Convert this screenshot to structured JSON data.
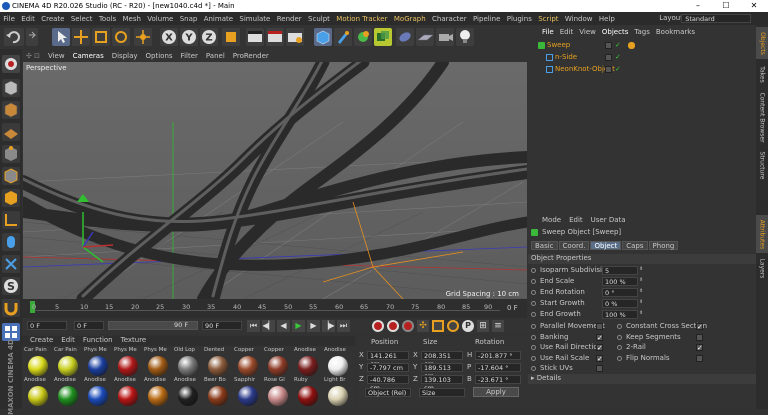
{
  "window": {
    "title": "CINEMA 4D R20.026 Studio (RC - R20) - [new1040.c4d *] - Main",
    "min": "–",
    "max": "☐",
    "close": "✕"
  },
  "menu": [
    "File",
    "Edit",
    "Create",
    "Select",
    "Tools",
    "Mesh",
    "Volume",
    "Snap",
    "Animate",
    "Simulate",
    "Render",
    "Sculpt",
    "Motion Tracker",
    "MoGraph",
    "Character",
    "Pipeline",
    "Plugins",
    "Script",
    "Window",
    "Help"
  ],
  "layout": {
    "label": "Layout:",
    "value": "Standard"
  },
  "axes": [
    "X",
    "Y",
    "Z"
  ],
  "view_menu": [
    "View",
    "Cameras",
    "Display",
    "Options",
    "Filter",
    "Panel",
    "ProRender"
  ],
  "viewport": {
    "label": "Perspective",
    "grid_spacing": "Grid Spacing : 10 cm"
  },
  "timeline": {
    "ticks": [
      "0",
      "5",
      "10",
      "15",
      "20",
      "25",
      "30",
      "35",
      "40",
      "45",
      "50",
      "55",
      "60",
      "65",
      "70",
      "75",
      "80",
      "85",
      "90"
    ],
    "end_label": "0 F"
  },
  "transport": {
    "start": "0 F",
    "current": "0 F",
    "end_a": "90 F",
    "end_b": "90 F"
  },
  "materials_menu": [
    "Create",
    "Edit",
    "Function",
    "Texture"
  ],
  "materials_row1": [
    {
      "name": "Car Pain",
      "color": "#d8d81a"
    },
    {
      "name": "Car Pain",
      "color": "#c8d020"
    },
    {
      "name": "Phys Me",
      "color": "#1a3e9e"
    },
    {
      "name": "Phys Me",
      "color": "#b01818"
    },
    {
      "name": "Phys Me",
      "color": "#a05a14"
    },
    {
      "name": "Old Lop",
      "color": "#7a7a7a"
    },
    {
      "name": "Dented",
      "color": "#8a5a3a"
    },
    {
      "name": "Copper",
      "color": "#9a4a2a"
    },
    {
      "name": "Copper",
      "color": "#8e3c28"
    },
    {
      "name": "Anodise",
      "color": "#7a1e1e"
    },
    {
      "name": "Anodise",
      "color": "#eeeeee"
    }
  ],
  "materials_row2": [
    {
      "name": "Anodise",
      "color": "#c8c818"
    },
    {
      "name": "Anodise",
      "color": "#1e8e1e"
    },
    {
      "name": "Anodise",
      "color": "#1a4ab8"
    },
    {
      "name": "Anodise",
      "color": "#b81414"
    },
    {
      "name": "Anodise",
      "color": "#b86a14"
    },
    {
      "name": "Anodise",
      "color": "#202020"
    },
    {
      "name": "Beer Bo",
      "color": "#8a3a1a"
    },
    {
      "name": "Sapphir",
      "color": "#2a3a8a"
    },
    {
      "name": "Rose Gl",
      "color": "#c88a8a"
    },
    {
      "name": "Ruby",
      "color": "#8e1010"
    },
    {
      "name": "Light Br",
      "color": "#d8d0b0"
    }
  ],
  "coords": {
    "headers": [
      "Position",
      "Size",
      "Rotation"
    ],
    "rows": [
      {
        "axis": "X",
        "pos": "141.261 cm",
        "sa": "X",
        "size": "208.351 cm",
        "ra": "H",
        "rot": "-201.877 °"
      },
      {
        "axis": "Y",
        "pos": "-7.797 cm",
        "sa": "Y",
        "size": "189.513 cm",
        "ra": "P",
        "rot": "-17.604 °"
      },
      {
        "axis": "Z",
        "pos": "-40.786 cm",
        "sa": "Z",
        "size": "139.103 cm",
        "ra": "B",
        "rot": "-23.671 °"
      }
    ],
    "mode": "Object (Rel)",
    "size_mode": "Size",
    "apply": "Apply"
  },
  "objects": {
    "tabs": [
      "File",
      "Edit",
      "View",
      "Objects",
      "Tags",
      "Bookmarks"
    ],
    "items": [
      {
        "name": "Sweep",
        "color": "#e8a020"
      },
      {
        "name": "n-Side",
        "color": "#e8a020"
      },
      {
        "name": "NeonKnot-Object",
        "color": "#e8a020"
      }
    ]
  },
  "attributes": {
    "menu": [
      "Mode",
      "Edit",
      "User Data"
    ],
    "object_title": "Sweep Object [Sweep]",
    "tabs": [
      "Basic",
      "Coord.",
      "Object",
      "Caps",
      "Phong"
    ],
    "section": "Object Properties",
    "fields": [
      {
        "label": "Isoparm Subdivision",
        "value": "5"
      },
      {
        "label": "End Scale",
        "value": "100 %"
      },
      {
        "label": "End Rotation",
        "value": "0 °"
      },
      {
        "label": "Start Growth",
        "value": "0 %"
      },
      {
        "label": "End Growth",
        "value": "100 %"
      }
    ],
    "checks_left": [
      {
        "label": "Parallel Movement",
        "checked": false
      },
      {
        "label": "Banking",
        "checked": true
      },
      {
        "label": "Use Rail Direction",
        "checked": true
      },
      {
        "label": "Use Rail Scale",
        "checked": true
      },
      {
        "label": "Stick UVs",
        "checked": false
      }
    ],
    "checks_right": [
      {
        "label": "Constant Cross Section",
        "checked": true
      },
      {
        "label": "Keep Segments",
        "checked": false
      },
      {
        "label": "2-Rail",
        "checked": true
      },
      {
        "label": "Flip Normals",
        "checked": false
      }
    ],
    "details": "Details"
  },
  "side_tabs": [
    "Objects",
    "Takes",
    "Content Browser",
    "Structure",
    "Attributes",
    "Layers"
  ],
  "logo": "MAXON CINEMA 4D"
}
